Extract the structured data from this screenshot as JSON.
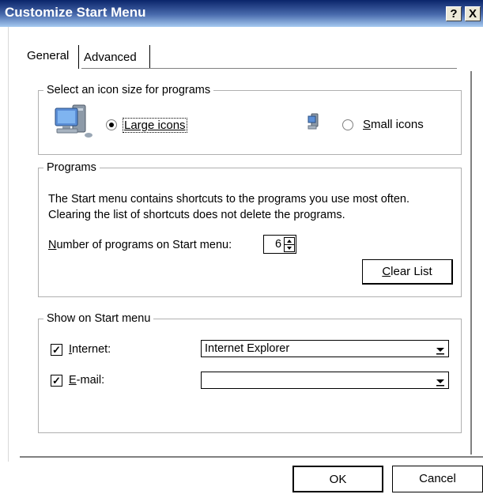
{
  "window": {
    "title": "Customize Start Menu",
    "help_label": "?",
    "close_label": "X"
  },
  "tabs": [
    {
      "label": "General",
      "selected": true
    },
    {
      "label": "Advanced",
      "selected": false
    }
  ],
  "icon_size": {
    "legend": "Select an icon size for programs",
    "large_label": "Large icons",
    "small_label": "Small icons",
    "selected": "large",
    "large_icon": "computer-large-icon",
    "small_icon": "computer-small-icon"
  },
  "programs": {
    "legend": "Programs",
    "description_line1": "The Start menu contains shortcuts to the programs you use most often.",
    "description_line2": "Clearing the list of shortcuts does not delete the programs.",
    "count_label_prefix": "N",
    "count_label_rest": "umber of programs on Start menu:",
    "count_value": "6",
    "clear_prefix": "C",
    "clear_rest": "lear List"
  },
  "show_on_start": {
    "legend": "Show on Start menu",
    "internet": {
      "label_prefix": "I",
      "label_rest": "nternet:",
      "checked": true,
      "value": "Internet Explorer"
    },
    "email": {
      "label_prefix": "E",
      "label_rest": "-mail:",
      "checked": true,
      "value": ""
    }
  },
  "buttons": {
    "ok": "OK",
    "cancel": "Cancel"
  },
  "colors": {
    "titlebar_start": "#0a246a",
    "titlebar_end": "#a6caf0"
  }
}
